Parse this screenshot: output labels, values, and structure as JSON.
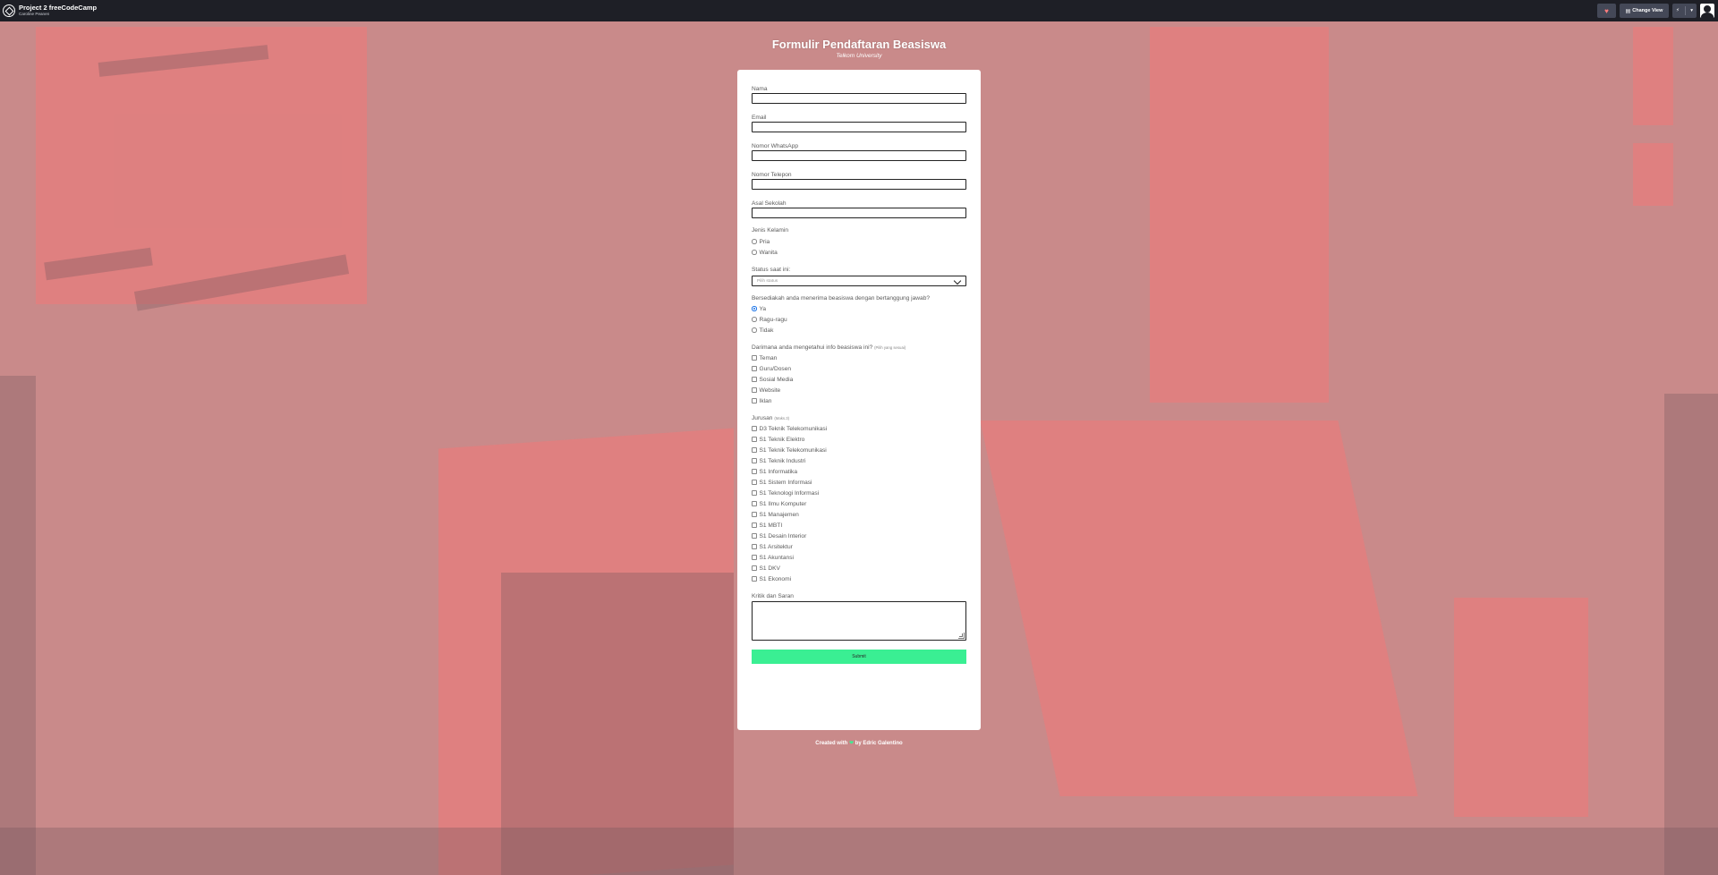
{
  "app": {
    "project_title": "Project 2 freeCodeCamp",
    "author": "Caroline Peanen",
    "change_view_label": "Change View",
    "heart_icon": "heart-icon",
    "grid_icon": "grid-icon",
    "rerun_icon": "rerun-icon",
    "menu_icon": "chevron-down-icon"
  },
  "header": {
    "title": "Formulir Pendaftaran Beasiswa",
    "subtitle": "Telkom University"
  },
  "form": {
    "nama_label": "Nama",
    "email_label": "Email",
    "whatsapp_label": "Nomor WhatsApp",
    "telepon_label": "Nomor Telepon",
    "sekolah_label": "Asal Sekolah",
    "gender_label": "Jenis Kelamin",
    "gender_options": [
      "Pria",
      "Wanita"
    ],
    "status_label": "Status saat ini:",
    "status_selected": "Pilih status",
    "bersedia_label": "Bersediakah anda menerima beasiswa dengan bertanggung jawab?",
    "bersedia_options": [
      "Ya",
      "Ragu-ragu",
      "Tidak"
    ],
    "bersedia_selected": "Ya",
    "info_label": "Darimana anda mengetahui info beasiswa ini?",
    "info_hint": "(Pilih yang sesuai)",
    "info_options": [
      "Teman",
      "Guru/Dosen",
      "Sosial Media",
      "Website",
      "Iklan"
    ],
    "jurusan_label": "Jurusan",
    "jurusan_hint": "(Maks.3)",
    "jurusan_options": [
      "D3 Teknik Telekomunikasi",
      "S1 Teknik Elektro",
      "S1 Teknik Telekomunikasi",
      "S1 Teknik Industri",
      "S1 Informatika",
      "S1 Sistem Informasi",
      "S1 Teknologi Informasi",
      "S1 Ilmu Komputer",
      "S1 Manajemen",
      "S1 MBTI",
      "S1 Desain Interior",
      "S1 Arsitektur",
      "S1 Akuntansi",
      "S1 DKV",
      "S1 Ekonomi"
    ],
    "kritik_label": "Kritik dan Saran",
    "submit_label": "Submit"
  },
  "footer": {
    "prefix": "Created with",
    "heart": "❤",
    "suffix": "by Edric Galentino"
  }
}
